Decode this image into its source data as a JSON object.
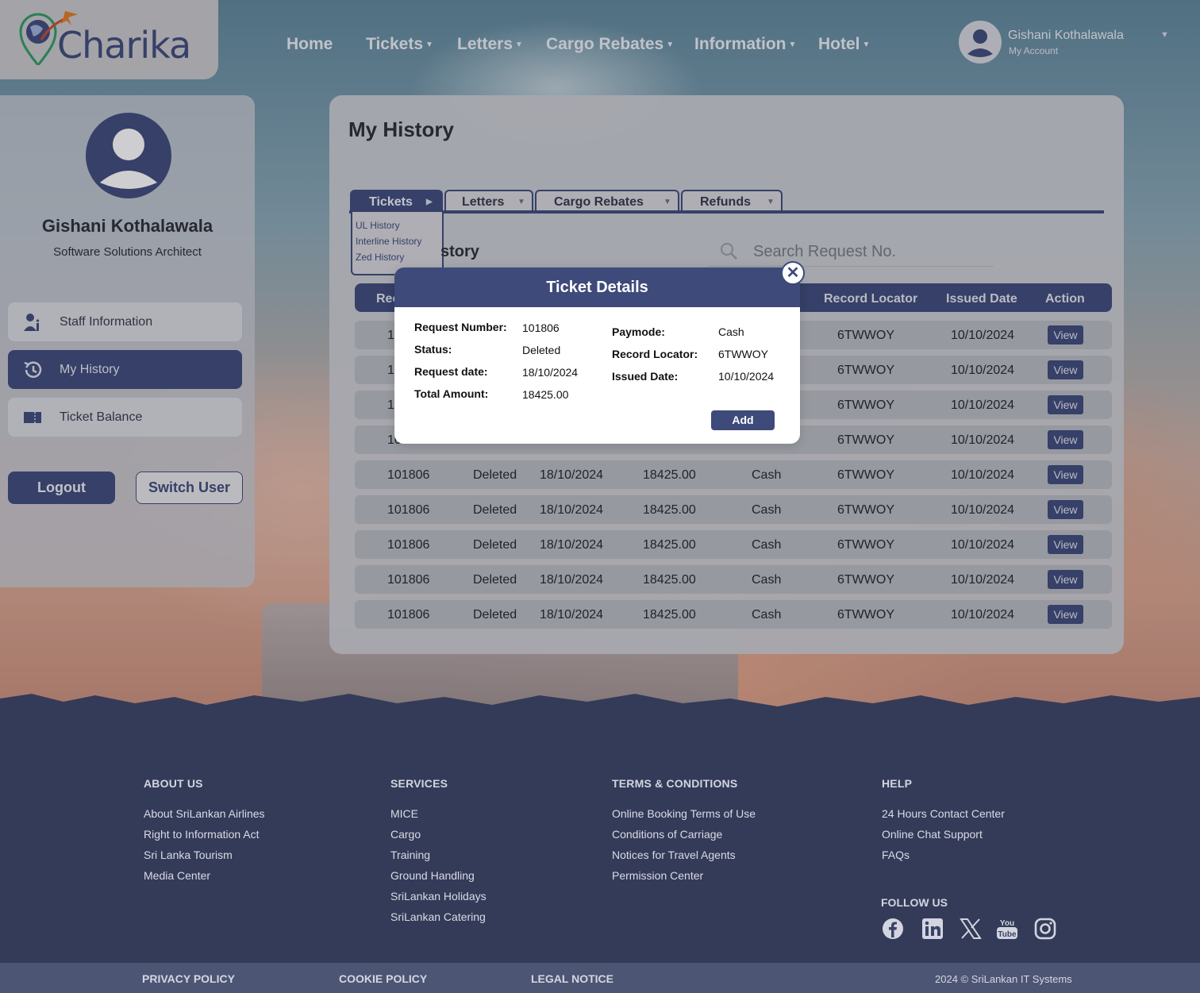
{
  "brand": {
    "name": "Charika"
  },
  "nav": {
    "items": [
      {
        "label": "Home",
        "has_dropdown": false
      },
      {
        "label": "Tickets",
        "has_dropdown": true
      },
      {
        "label": "Letters",
        "has_dropdown": true
      },
      {
        "label": "Cargo Rebates",
        "has_dropdown": true
      },
      {
        "label": "Information",
        "has_dropdown": true
      },
      {
        "label": "Hotel",
        "has_dropdown": true
      }
    ]
  },
  "account": {
    "name": "Gishani Kothalawala",
    "sub": "My Account"
  },
  "sidebar": {
    "user_name": "Gishani Kothalawala",
    "user_role": "Software Solutions Architect",
    "items": [
      {
        "label": "Staff Information",
        "icon": "staff-info-icon",
        "active": false
      },
      {
        "label": "My History",
        "icon": "history-icon",
        "active": true
      },
      {
        "label": "Ticket Balance",
        "icon": "ticket-icon",
        "active": false
      }
    ],
    "logout_label": "Logout",
    "switch_label": "Switch User"
  },
  "main": {
    "title": "My History",
    "tabs": [
      {
        "label": "Tickets",
        "active": true
      },
      {
        "label": "Letters",
        "active": false
      },
      {
        "label": "Cargo Rebates",
        "active": false
      },
      {
        "label": "Refunds",
        "active": false
      }
    ],
    "tickets_menu": [
      "UL History",
      "Interline History",
      "Zed History"
    ],
    "section_title_visible": "story",
    "search_placeholder": "Search Request No.",
    "table": {
      "headers_visible": [
        "Rec",
        "Record Locator",
        "Issued Date",
        "Action"
      ],
      "partial_rows": [
        {
          "req": "1",
          "locator": "6TWWOY",
          "issued": "10/10/2024",
          "action": "View"
        },
        {
          "req": "1",
          "locator": "6TWWOY",
          "issued": "10/10/2024",
          "action": "View"
        },
        {
          "req": "1",
          "locator": "6TWWOY",
          "issued": "10/10/2024",
          "action": "View"
        },
        {
          "req": "10",
          "locator": "6TWWOY",
          "issued": "10/10/2024",
          "action": "View"
        }
      ],
      "rows": [
        {
          "req": "101806",
          "status": "Deleted",
          "date": "18/10/2024",
          "amount": "18425.00",
          "paymode": "Cash",
          "locator": "6TWWOY",
          "issued": "10/10/2024",
          "action": "View"
        },
        {
          "req": "101806",
          "status": "Deleted",
          "date": "18/10/2024",
          "amount": "18425.00",
          "paymode": "Cash",
          "locator": "6TWWOY",
          "issued": "10/10/2024",
          "action": "View"
        },
        {
          "req": "101806",
          "status": "Deleted",
          "date": "18/10/2024",
          "amount": "18425.00",
          "paymode": "Cash",
          "locator": "6TWWOY",
          "issued": "10/10/2024",
          "action": "View"
        },
        {
          "req": "101806",
          "status": "Deleted",
          "date": "18/10/2024",
          "amount": "18425.00",
          "paymode": "Cash",
          "locator": "6TWWOY",
          "issued": "10/10/2024",
          "action": "View"
        },
        {
          "req": "101806",
          "status": "Deleted",
          "date": "18/10/2024",
          "amount": "18425.00",
          "paymode": "Cash",
          "locator": "6TWWOY",
          "issued": "10/10/2024",
          "action": "View"
        }
      ]
    }
  },
  "modal": {
    "title": "Ticket Details",
    "close": "✕",
    "left": [
      {
        "k": "Request Number:",
        "v": "101806"
      },
      {
        "k": "Status:",
        "v": "Deleted"
      },
      {
        "k": "Request date:",
        "v": "18/10/2024"
      },
      {
        "k": "Total Amount:",
        "v": "18425.00"
      }
    ],
    "right": [
      {
        "k": "Paymode:",
        "v": "Cash"
      },
      {
        "k": "Record Locator:",
        "v": "6TWWOY"
      },
      {
        "k": "Issued Date:",
        "v": "10/10/2024"
      }
    ],
    "add_label": "Add"
  },
  "footer": {
    "columns": [
      {
        "heading": "ABOUT US",
        "links": [
          "About SriLankan Airlines",
          "Right to Information Act",
          "Sri Lanka Tourism",
          "Media Center"
        ]
      },
      {
        "heading": "SERVICES",
        "links": [
          "MICE",
          "Cargo",
          "Training",
          "Ground Handling",
          "SriLankan Holidays",
          "SriLankan Catering"
        ]
      },
      {
        "heading": "TERMS & CONDITIONS",
        "links": [
          "Online Booking Terms of Use",
          "Conditions of Carriage",
          "Notices for Travel Agents",
          "Permission Center"
        ]
      },
      {
        "heading": "HELP",
        "links": [
          "24 Hours Contact Center",
          "Online Chat Support",
          "FAQs"
        ]
      }
    ],
    "follow_us": "FOLLOW US",
    "social": [
      "facebook-icon",
      "linkedin-icon",
      "x-icon",
      "youtube-icon",
      "instagram-icon"
    ],
    "bottom_links": [
      "PRIVACY POLICY",
      "COOKIE POLICY",
      "LEGAL NOTICE"
    ],
    "copyright": "2024 © SriLankan IT Systems"
  },
  "colors": {
    "brand_navy": "#3d4a7a",
    "footer_bg": "#3a4366",
    "logo_orange": "#e07b22"
  }
}
